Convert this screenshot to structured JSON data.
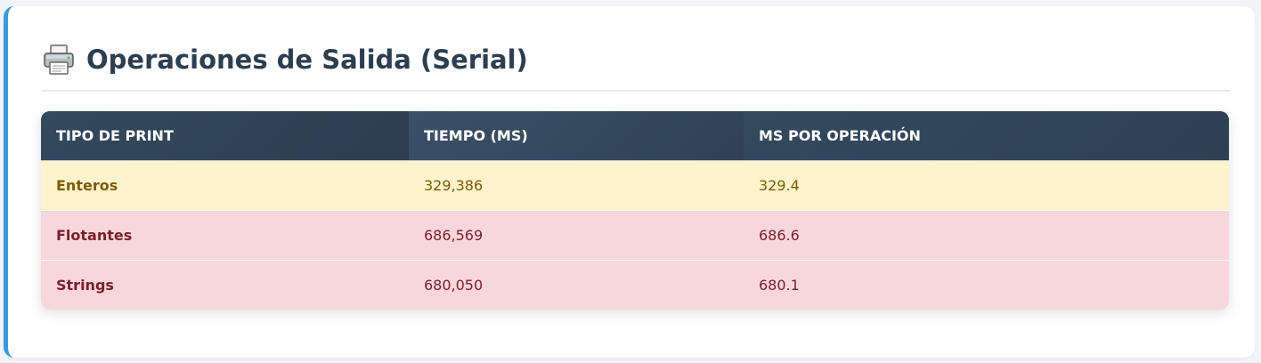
{
  "section": {
    "icon": "printer-icon",
    "title": "Operaciones de Salida (Serial)"
  },
  "table": {
    "headers": [
      "Tipo de Print",
      "Tiempo (ms)",
      "ms por Operación"
    ],
    "rows": [
      {
        "tipo": "Enteros",
        "tiempo": "329,386",
        "ms_op": "329.4",
        "status": "warning"
      },
      {
        "tipo": "Flotantes",
        "tiempo": "686,569",
        "ms_op": "686.6",
        "status": "danger"
      },
      {
        "tipo": "Strings",
        "tiempo": "680,050",
        "ms_op": "680.1",
        "status": "danger"
      }
    ]
  },
  "colors": {
    "accent": "#3a9ad9",
    "header_bg": "#34495e",
    "warning_bg": "#fef3cd",
    "danger_bg": "#f7d7db"
  }
}
